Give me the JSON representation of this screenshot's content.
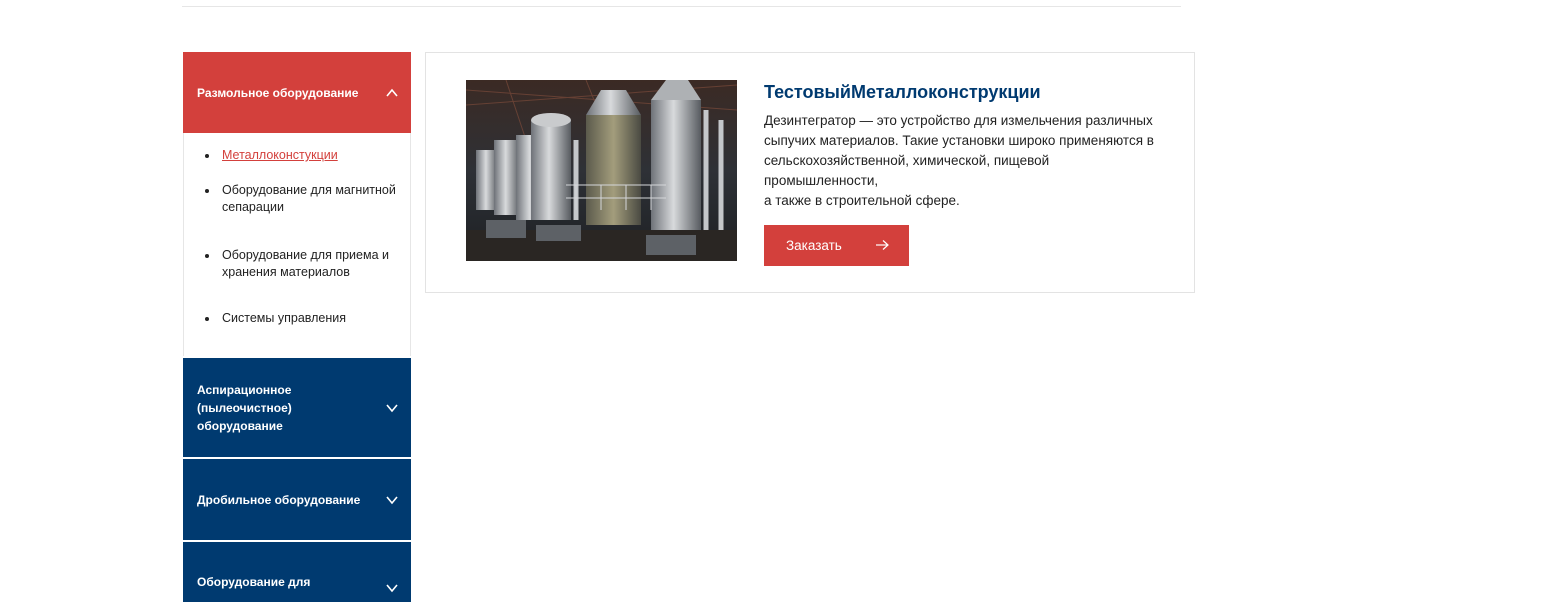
{
  "sidebar": {
    "active_category": "Размольное оборудование",
    "subitems": [
      "Металлоконстукции",
      "Оборудование для магнитной сепарации",
      "Оборудование для приема и хранения материалов",
      "Системы управления"
    ],
    "categories": [
      "Аспирационное (пылеочистное) оборудование",
      "Дробильное оборудование",
      "Оборудование для"
    ]
  },
  "product": {
    "title": "ТестовыйМеталлоконструкции",
    "description": "Дезинтегратор — это устройство для измельчения различных сыпучих материалов. Такие установки широко применяются в сельскохозяйственной, химической, пищевой промышленности,\nа также в строительной сфере.",
    "order_label": "Заказать"
  },
  "colors": {
    "accent_red": "#d3403c",
    "navy": "#003a70"
  },
  "icons": {
    "expanded": "chevron-up-icon",
    "collapsed": "chevron-down-icon",
    "button": "arrow-right-icon"
  }
}
